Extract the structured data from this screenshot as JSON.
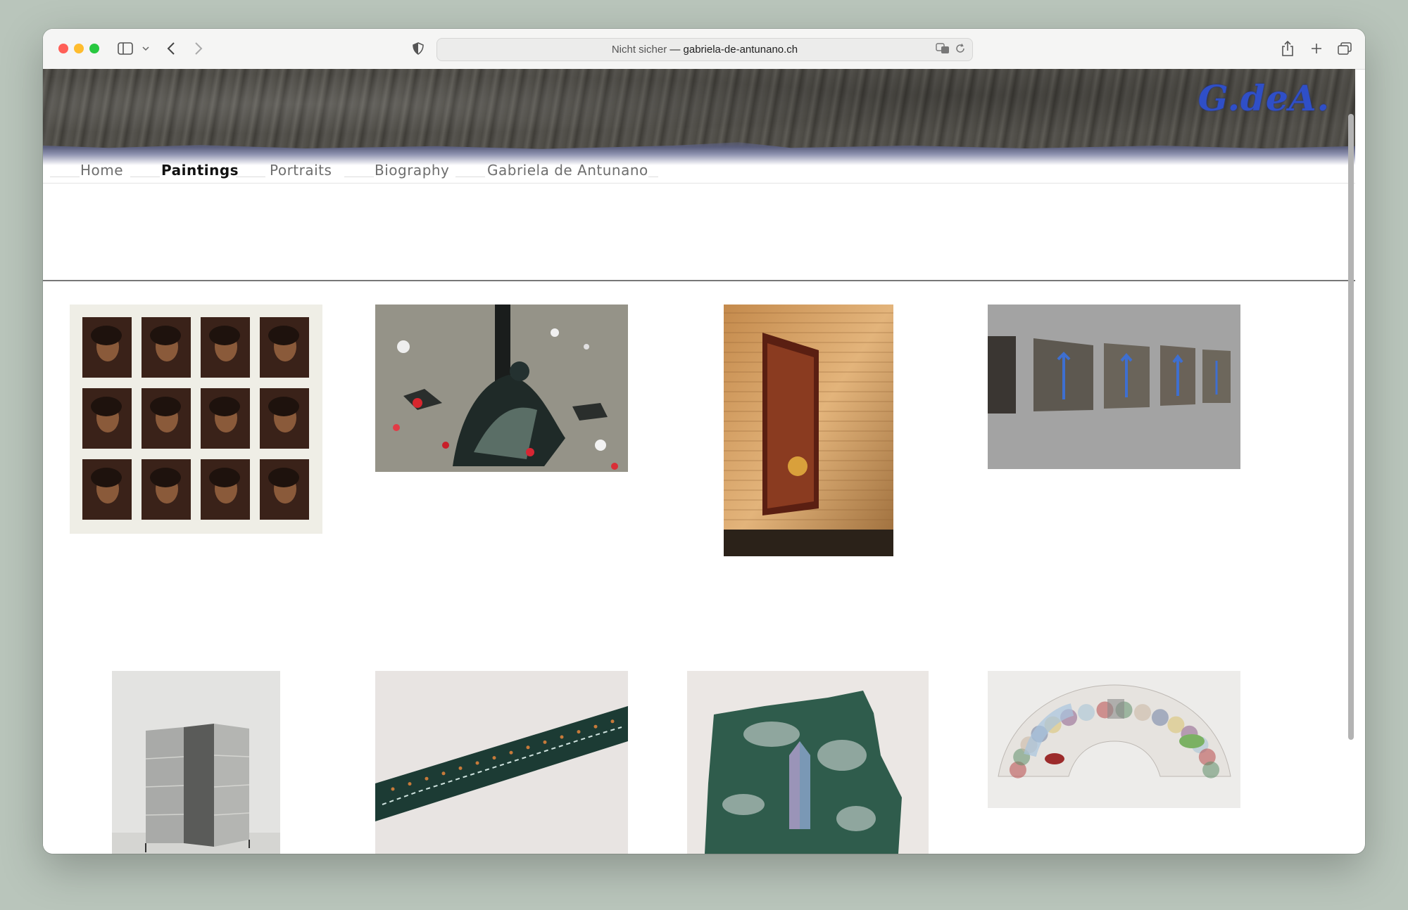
{
  "browser": {
    "secure_label": "Nicht sicher",
    "separator": " — ",
    "domain": "gabriela-de-antunano.ch"
  },
  "site": {
    "logo": "G.deA."
  },
  "nav": {
    "items": [
      {
        "label": "Home",
        "active": false
      },
      {
        "label": "Paintings",
        "active": true
      },
      {
        "label": "Portraits",
        "active": false
      },
      {
        "label": "Biography",
        "active": false
      },
      {
        "label": "Gabriela de Antunano",
        "active": false
      }
    ]
  },
  "gallery": {
    "items": [
      {
        "name": "grid-of-portraits"
      },
      {
        "name": "pieta-painting"
      },
      {
        "name": "canvas-in-brick-corner"
      },
      {
        "name": "row-of-panels"
      },
      {
        "name": "folding-screen"
      },
      {
        "name": "diagonal-green-strip"
      },
      {
        "name": "green-torn-canvas"
      },
      {
        "name": "fan-shaped-collage"
      }
    ]
  }
}
